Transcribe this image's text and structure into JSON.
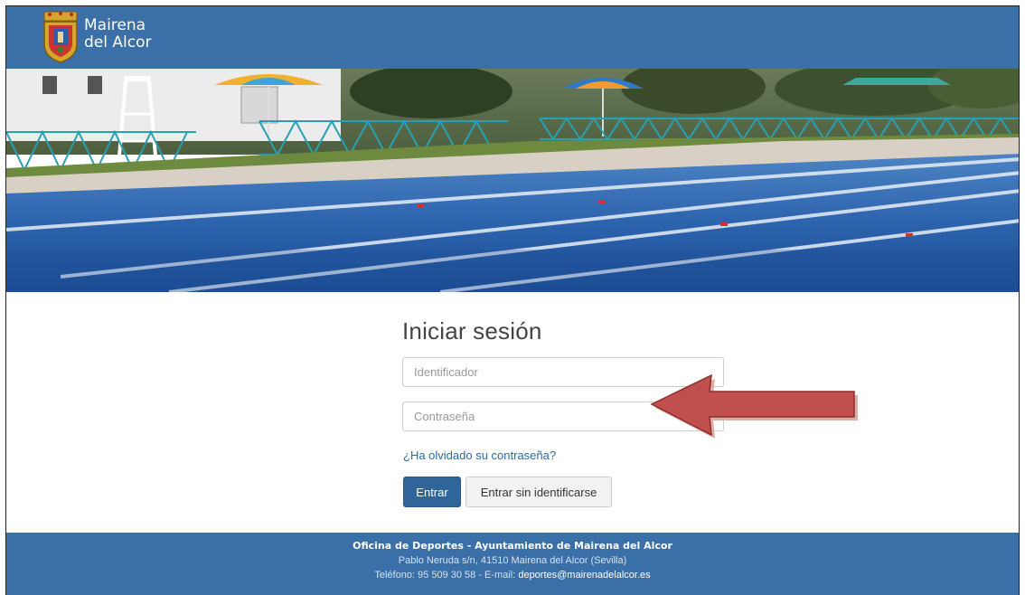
{
  "header": {
    "brand_line1": "Mairena",
    "brand_line2": "del Alcor"
  },
  "login": {
    "title": "Iniciar sesión",
    "username_placeholder": "Identificador",
    "password_placeholder": "Contraseña",
    "forgot_link": "¿Ha olvidado su contraseña?",
    "submit_label": "Entrar",
    "guest_label": "Entrar sin identificarse"
  },
  "footer": {
    "office": "Oficina de Deportes - Ayuntamiento de Mairena del Alcor",
    "address": "Pablo Neruda s/n, 41510 Mairena del Alcor (Sevilla)",
    "contact_prefix": "Teléfono: 95 509 30 58 - E-mail: ",
    "email": "deportes@mairenadelalcor.es"
  },
  "colors": {
    "header_bg": "#3b6fa8",
    "primary_button": "#2f6598",
    "arrow": "#c0504d"
  },
  "icons": {
    "logo": "municipal-shield-icon",
    "annotation": "left-arrow-icon"
  }
}
